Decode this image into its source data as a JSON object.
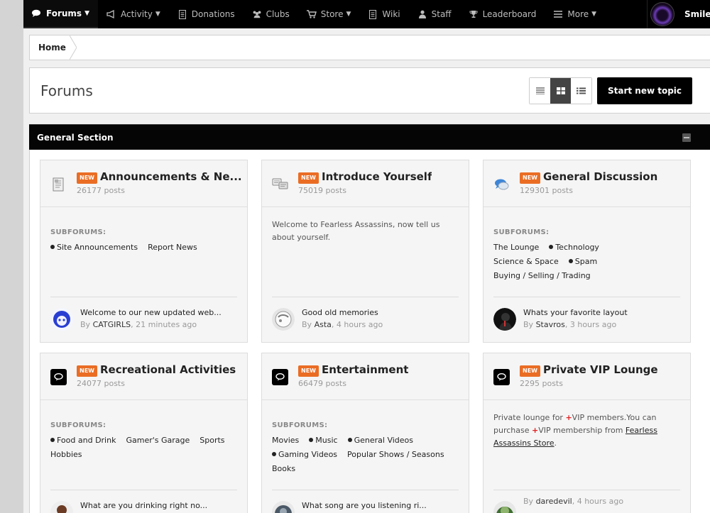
{
  "nav": {
    "items": [
      {
        "label": "Forums",
        "icon": "chat-icon",
        "caret": true,
        "active": true
      },
      {
        "label": "Activity",
        "icon": "megaphone-icon",
        "caret": true
      },
      {
        "label": "Donations",
        "icon": "document-icon"
      },
      {
        "label": "Clubs",
        "icon": "users-icon"
      },
      {
        "label": "Store",
        "icon": "cart-icon",
        "caret": true
      },
      {
        "label": "Wiki",
        "icon": "document-icon"
      },
      {
        "label": "Staff",
        "icon": "user-icon"
      },
      {
        "label": "Leaderboard",
        "icon": "trophy-icon"
      },
      {
        "label": "More",
        "icon": "menu-icon",
        "caret": true
      }
    ],
    "user_name": "Smiley"
  },
  "breadcrumb": {
    "home": "Home"
  },
  "header": {
    "title": "Forums",
    "start_topic": "Start new topic"
  },
  "section": {
    "title": "General Section"
  },
  "forums": [
    {
      "title": "Announcements & Ne...",
      "posts": "26177 posts",
      "badge": "NEW",
      "icon": "news-icon",
      "subforums_label": "SUBFORUMS:",
      "subforums": [
        {
          "name": "Site Announcements",
          "unread": true
        },
        {
          "name": "Report News",
          "unread": false
        }
      ],
      "last_post": {
        "title": "Welcome to our new updated web...",
        "by": "By",
        "author": "CATGIRLS",
        "time": ", 21 minutes ago"
      }
    },
    {
      "title": "Introduce Yourself",
      "posts": "75019 posts",
      "badge": "NEW",
      "icon": "chat-bubbles-icon",
      "description": "Welcome to Fearless Assassins, now tell us about yourself.",
      "last_post": {
        "title": "Good old memories",
        "by": "By",
        "author": "Asta",
        "time": ", 4 hours ago"
      }
    },
    {
      "title": "General Discussion",
      "posts": "129301 posts",
      "badge": "NEW",
      "icon": "discussion-icon",
      "subforums_label": "SUBFORUMS:",
      "subforums": [
        {
          "name": "The Lounge",
          "unread": false
        },
        {
          "name": "Technology",
          "unread": true
        },
        {
          "name": "Science & Space",
          "unread": false
        },
        {
          "name": "Spam",
          "unread": true
        },
        {
          "name": "Buying / Selling / Trading",
          "unread": false
        }
      ],
      "last_post": {
        "title": "Whats your favorite layout",
        "by": "By",
        "author": "Stavros",
        "time": ", 3 hours ago"
      }
    },
    {
      "title": "Recreational Activities",
      "posts": "24077 posts",
      "badge": "NEW",
      "icon": "comment-icon",
      "subforums_label": "SUBFORUMS:",
      "subforums": [
        {
          "name": "Food and Drink",
          "unread": true
        },
        {
          "name": "Gamer's Garage",
          "unread": false
        },
        {
          "name": "Sports",
          "unread": false
        },
        {
          "name": "Hobbies",
          "unread": false
        }
      ],
      "last_post": {
        "title": "What are you drinking right no...",
        "by": "",
        "author": "",
        "time": ""
      }
    },
    {
      "title": "Entertainment",
      "posts": "66479 posts",
      "badge": "NEW",
      "icon": "comment-icon",
      "subforums_label": "SUBFORUMS:",
      "subforums": [
        {
          "name": "Movies",
          "unread": false
        },
        {
          "name": "Music",
          "unread": true
        },
        {
          "name": "General Videos",
          "unread": true
        },
        {
          "name": "Gaming Videos",
          "unread": true
        },
        {
          "name": "Popular Shows / Seasons",
          "unread": false
        },
        {
          "name": "Books",
          "unread": false
        }
      ],
      "last_post": {
        "title": "What song are you listening ri...",
        "by": "",
        "author": "",
        "time": ""
      }
    },
    {
      "title": "Private VIP Lounge",
      "posts": "2295 posts",
      "badge": "NEW",
      "icon": "comment-icon",
      "description_parts": [
        "Private lounge for ",
        "+",
        "VIP members.You can purchase ",
        "+",
        "VIP membership from ",
        "Fearless Assassins Store",
        "."
      ],
      "last_post": {
        "title": "",
        "by": "By",
        "author": "daredevil",
        "time": ", 4 hours ago"
      }
    }
  ],
  "colors": {
    "accent_badge": "#ea6d24",
    "nav_bg": "#000000",
    "vip_plus": "#e02020"
  }
}
